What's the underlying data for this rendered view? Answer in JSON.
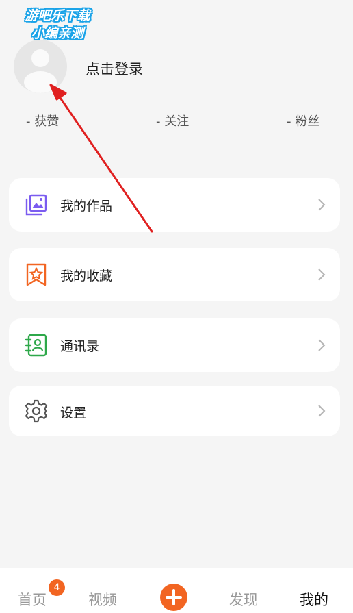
{
  "watermark": {
    "line1": "游吧乐下载",
    "line2": "小编亲测"
  },
  "profile": {
    "login_label": "点击登录"
  },
  "stats": [
    {
      "label": "- 获赞"
    },
    {
      "label": "- 关注"
    },
    {
      "label": "- 粉丝"
    }
  ],
  "menu": [
    {
      "label": "我的作品",
      "icon": "gallery-icon",
      "color": "#7b5cf0"
    },
    {
      "label": "我的收藏",
      "icon": "favorite-star-icon",
      "color": "#f26522"
    },
    {
      "label": "通讯录",
      "icon": "contacts-book-icon",
      "color": "#2ea84a"
    },
    {
      "label": "设置",
      "icon": "gear-icon",
      "color": "#555555"
    }
  ],
  "tabbar": {
    "home": "首页",
    "home_badge": "4",
    "video": "视频",
    "discover": "发现",
    "mine": "我的"
  },
  "colors": {
    "accent": "#f26522",
    "annotation_arrow": "#e02020"
  }
}
